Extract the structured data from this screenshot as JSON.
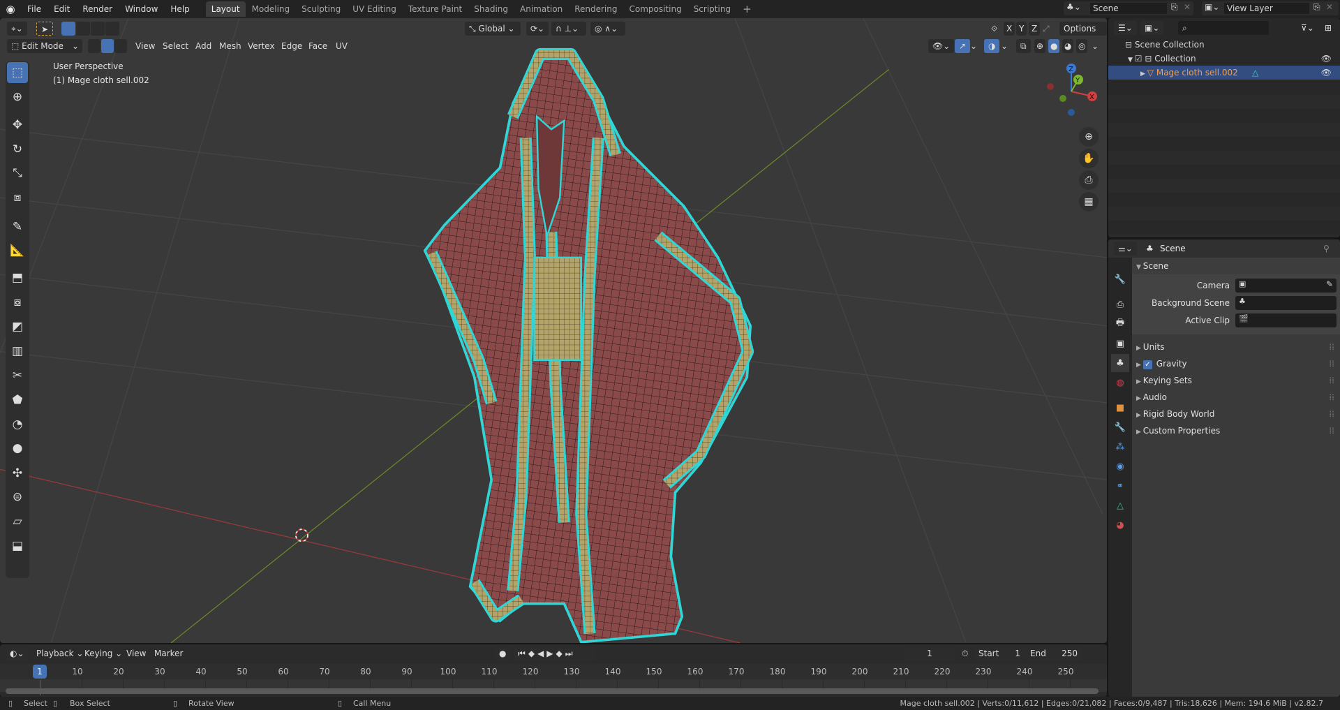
{
  "topbar": {
    "menus": [
      "File",
      "Edit",
      "Render",
      "Window",
      "Help"
    ],
    "tabs": [
      "Layout",
      "Modeling",
      "Sculpting",
      "UV Editing",
      "Texture Paint",
      "Shading",
      "Animation",
      "Rendering",
      "Compositing",
      "Scripting"
    ],
    "add_tab": "+",
    "scene": "Scene",
    "view_layer": "View Layer"
  },
  "viewport_header": {
    "mode": "Edit Mode",
    "menus": [
      "View",
      "Select",
      "Add",
      "Mesh",
      "Vertex",
      "Edge",
      "Face",
      "UV"
    ],
    "orientation": "Global",
    "axes": [
      "X",
      "Y",
      "Z"
    ],
    "options": "Options"
  },
  "viewport": {
    "view_name": "User Perspective",
    "object_label": "(1) Mage cloth sell.002",
    "gizmo": {
      "x": "X",
      "y": "Y",
      "z": "Z"
    }
  },
  "toolbar": [
    "select-box",
    "cursor",
    "move",
    "rotate",
    "scale",
    "transform",
    "annotate",
    "measure",
    "extrude",
    "inset",
    "bevel",
    "loop-cut",
    "knife",
    "poly-build",
    "spin",
    "smooth",
    "edge-slide",
    "shrink-fatten",
    "shear",
    "rip"
  ],
  "outliner": {
    "root": "Scene Collection",
    "collection": "Collection",
    "object": "Mage cloth sell.002",
    "search_placeholder": ""
  },
  "properties": {
    "header": "Scene",
    "panel": "Scene",
    "fields": [
      {
        "label": "Camera",
        "value": ""
      },
      {
        "label": "Background Scene",
        "value": ""
      },
      {
        "label": "Active Clip",
        "value": ""
      }
    ],
    "sections": [
      "Units",
      "Gravity",
      "Keying Sets",
      "Audio",
      "Rigid Body World",
      "Custom Properties"
    ],
    "gravity_enabled": true
  },
  "timeline": {
    "menus": [
      "Playback",
      "Keying",
      "View",
      "Marker"
    ],
    "current_frame": "1",
    "start_label": "Start",
    "start": "1",
    "end_label": "End",
    "end": "250",
    "ticks": [
      "10",
      "20",
      "30",
      "40",
      "50",
      "60",
      "70",
      "80",
      "90",
      "100",
      "110",
      "120",
      "130",
      "140",
      "150",
      "160",
      "170",
      "180",
      "190",
      "200",
      "210",
      "220",
      "230",
      "240",
      "250"
    ],
    "playhead": "1"
  },
  "status": {
    "hints": [
      "Select",
      "Box Select",
      "Rotate View",
      "Call Menu"
    ],
    "stats": "Mage cloth sell.002 | Verts:0/11,612 | Edges:0/21,082 | Faces:0/9,487 | Tris:18,626 | Mem: 194.6 MiB | v2.82.7"
  },
  "colors": {
    "accent": "#4772b3",
    "selected_edge": "#2fd6d6",
    "cloth": "#8a4848",
    "trim": "#b4a46a"
  }
}
